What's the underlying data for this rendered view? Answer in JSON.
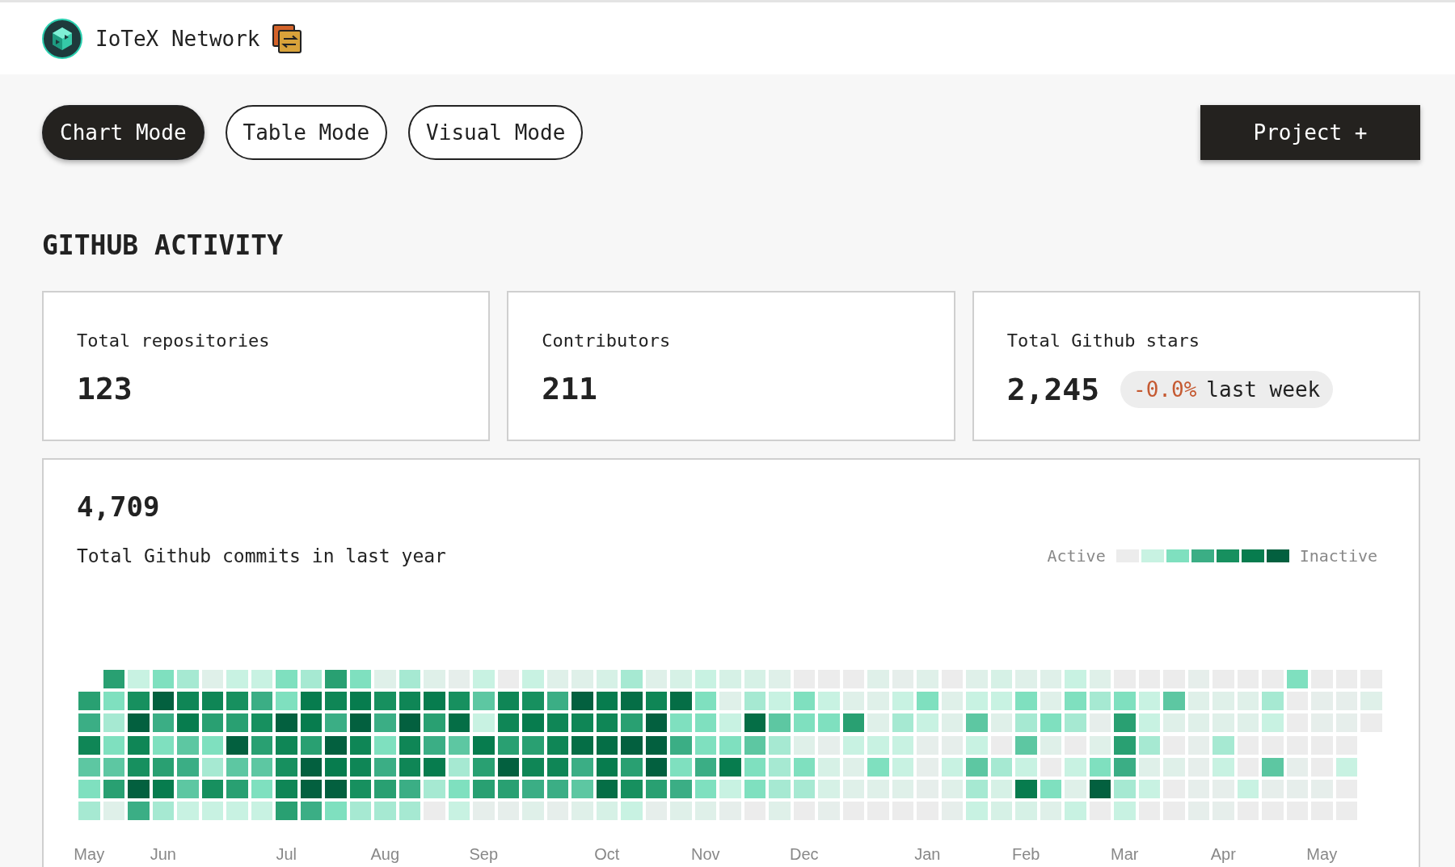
{
  "header": {
    "title": "IoTeX Network"
  },
  "modes": [
    {
      "label": "Chart Mode",
      "selected": true
    },
    {
      "label": "Table Mode",
      "selected": false
    },
    {
      "label": "Visual Mode",
      "selected": false
    }
  ],
  "project_button": "Project +",
  "section_title": "GITHUB ACTIVITY",
  "stats": [
    {
      "label": "Total repositories",
      "value": "123"
    },
    {
      "label": "Contributors",
      "value": "211"
    },
    {
      "label": "Total Github stars",
      "value": "2,245",
      "change": "-0.0%",
      "change_period": "last week"
    }
  ],
  "commits": {
    "total": "4,709",
    "caption": "Total Github commits in last year",
    "legend": {
      "start_label": "Active",
      "end_label": "Inactive",
      "swatches": [
        {
          "color": "#ececec"
        },
        {
          "color": "#c8f2e2"
        },
        {
          "color": "#7fe0bf"
        },
        {
          "color": "#3bae85"
        },
        {
          "color": "#17905f"
        },
        {
          "color": "#077c4e"
        },
        {
          "color": "#03603f"
        }
      ]
    },
    "weeks": [
      {
        "month": "May",
        "days": [
          {
            "color": "#29a072"
          },
          {
            "color": "#3bae85"
          },
          {
            "color": "#0f8656"
          },
          {
            "color": "#5dc7a2"
          },
          {
            "color": "#7fe0bf"
          },
          {
            "color": "#a6e9d2"
          }
        ]
      },
      {
        "days": [
          {
            "color": "#29a072"
          },
          {
            "color": "#7fe0bf"
          },
          {
            "color": "#a6e9d2"
          },
          {
            "color": "#7fe0bf"
          },
          {
            "color": "#5dc7a2"
          },
          {
            "color": "#29a072"
          },
          {
            "color": "#dff0e9"
          }
        ]
      },
      {
        "days": [
          {
            "color": "#c8f2e2"
          },
          {
            "color": "#17905f"
          },
          {
            "color": "#03603f"
          },
          {
            "color": "#0f8656"
          },
          {
            "color": "#17905f"
          },
          {
            "color": "#03603f"
          },
          {
            "color": "#3bae85"
          }
        ]
      },
      {
        "month": "Jun",
        "days": [
          {
            "color": "#7fe0bf"
          },
          {
            "color": "#03603f"
          },
          {
            "color": "#3bae85"
          },
          {
            "color": "#7fe0bf"
          },
          {
            "color": "#29a072"
          },
          {
            "color": "#077c4e"
          },
          {
            "color": "#a6e9d2"
          }
        ]
      },
      {
        "days": [
          {
            "color": "#a6e9d2"
          },
          {
            "color": "#0f8656"
          },
          {
            "color": "#077c4e"
          },
          {
            "color": "#5dc7a2"
          },
          {
            "color": "#3bae85"
          },
          {
            "color": "#5dc7a2"
          },
          {
            "color": "#c8f2e2"
          }
        ]
      },
      {
        "days": [
          {
            "color": "#dff0e9"
          },
          {
            "color": "#0f8656"
          },
          {
            "color": "#29a072"
          },
          {
            "color": "#7fe0bf"
          },
          {
            "color": "#a6e9d2"
          },
          {
            "color": "#17905f"
          },
          {
            "color": "#c8f2e2"
          }
        ]
      },
      {
        "days": [
          {
            "color": "#c8f2e2"
          },
          {
            "color": "#17905f"
          },
          {
            "color": "#29a072"
          },
          {
            "color": "#03603f"
          },
          {
            "color": "#5dc7a2"
          },
          {
            "color": "#29a072"
          },
          {
            "color": "#c8f2e2"
          }
        ]
      },
      {
        "days": [
          {
            "color": "#c8f2e2"
          },
          {
            "color": "#3bae85"
          },
          {
            "color": "#17905f"
          },
          {
            "color": "#29a072"
          },
          {
            "color": "#5dc7a2"
          },
          {
            "color": "#7fe0bf"
          },
          {
            "color": "#c8f2e2"
          }
        ]
      },
      {
        "month": "Jul",
        "days": [
          {
            "color": "#7fe0bf"
          },
          {
            "color": "#7fe0bf"
          },
          {
            "color": "#03603f"
          },
          {
            "color": "#0f8656"
          },
          {
            "color": "#17905f"
          },
          {
            "color": "#0f8656"
          },
          {
            "color": "#29a072"
          }
        ]
      },
      {
        "days": [
          {
            "color": "#a6e9d2"
          },
          {
            "color": "#077c4e"
          },
          {
            "color": "#077c4e"
          },
          {
            "color": "#29a072"
          },
          {
            "color": "#03603f"
          },
          {
            "color": "#03603f"
          },
          {
            "color": "#3bae85"
          }
        ]
      },
      {
        "days": [
          {
            "color": "#29a072"
          },
          {
            "color": "#0f8656"
          },
          {
            "color": "#3bae85"
          },
          {
            "color": "#03603f"
          },
          {
            "color": "#077c4e"
          },
          {
            "color": "#03603f"
          },
          {
            "color": "#7fe0bf"
          }
        ]
      },
      {
        "days": [
          {
            "color": "#7fe0bf"
          },
          {
            "color": "#077c4e"
          },
          {
            "color": "#03603f"
          },
          {
            "color": "#0f8656"
          },
          {
            "color": "#0f8656"
          },
          {
            "color": "#17905f"
          },
          {
            "color": "#a6e9d2"
          }
        ]
      },
      {
        "month": "Aug",
        "days": [
          {
            "color": "#dff0e9"
          },
          {
            "color": "#17905f"
          },
          {
            "color": "#3bae85"
          },
          {
            "color": "#7fe0bf"
          },
          {
            "color": "#3bae85"
          },
          {
            "color": "#29a072"
          },
          {
            "color": "#a6e9d2"
          }
        ]
      },
      {
        "days": [
          {
            "color": "#a6e9d2"
          },
          {
            "color": "#0f8656"
          },
          {
            "color": "#03603f"
          },
          {
            "color": "#0f8656"
          },
          {
            "color": "#0f8656"
          },
          {
            "color": "#3bae85"
          },
          {
            "color": "#a6e9d2"
          }
        ]
      },
      {
        "days": [
          {
            "color": "#dff0e9"
          },
          {
            "color": "#077c4e"
          },
          {
            "color": "#29a072"
          },
          {
            "color": "#3bae85"
          },
          {
            "color": "#077c4e"
          },
          {
            "color": "#a6e9d2"
          },
          {
            "color": "#ececec"
          }
        ]
      },
      {
        "days": [
          {
            "color": "#e6eeeb"
          },
          {
            "color": "#17905f"
          },
          {
            "color": "#056e46"
          },
          {
            "color": "#5dc7a2"
          },
          {
            "color": "#a6e9d2"
          },
          {
            "color": "#7fe0bf"
          },
          {
            "color": "#c8f2e2"
          }
        ]
      },
      {
        "month": "Sep",
        "days": [
          {
            "color": "#c8f2e2"
          },
          {
            "color": "#5dc7a2"
          },
          {
            "color": "#c8f2e2"
          },
          {
            "color": "#077c4e"
          },
          {
            "color": "#29a072"
          },
          {
            "color": "#29a072"
          },
          {
            "color": "#e6eeeb"
          }
        ]
      },
      {
        "days": [
          {
            "color": "#ececec"
          },
          {
            "color": "#0f8656"
          },
          {
            "color": "#0f8656"
          },
          {
            "color": "#29a072"
          },
          {
            "color": "#03603f"
          },
          {
            "color": "#29a072"
          },
          {
            "color": "#e6eeeb"
          }
        ]
      },
      {
        "days": [
          {
            "color": "#c8f2e2"
          },
          {
            "color": "#17905f"
          },
          {
            "color": "#077c4e"
          },
          {
            "color": "#29a072"
          },
          {
            "color": "#0f8656"
          },
          {
            "color": "#3bae85"
          },
          {
            "color": "#dff0e9"
          }
        ]
      },
      {
        "days": [
          {
            "color": "#dff0e9"
          },
          {
            "color": "#3bae85"
          },
          {
            "color": "#0f8656"
          },
          {
            "color": "#0f8656"
          },
          {
            "color": "#0f8656"
          },
          {
            "color": "#3bae85"
          },
          {
            "color": "#e6eeeb"
          }
        ]
      },
      {
        "days": [
          {
            "color": "#dff0e9"
          },
          {
            "color": "#03603f"
          },
          {
            "color": "#0f8656"
          },
          {
            "color": "#056e46"
          },
          {
            "color": "#3bae85"
          },
          {
            "color": "#5dc7a2"
          },
          {
            "color": "#dff0e9"
          }
        ]
      },
      {
        "month": "Oct",
        "days": [
          {
            "color": "#d6f1e6"
          },
          {
            "color": "#077c4e"
          },
          {
            "color": "#0f8656"
          },
          {
            "color": "#056e46"
          },
          {
            "color": "#077c4e"
          },
          {
            "color": "#056e46"
          },
          {
            "color": "#d6f1e6"
          }
        ]
      },
      {
        "days": [
          {
            "color": "#a6e9d2"
          },
          {
            "color": "#056e46"
          },
          {
            "color": "#29a072"
          },
          {
            "color": "#03603f"
          },
          {
            "color": "#29a072"
          },
          {
            "color": "#17905f"
          },
          {
            "color": "#c8f2e2"
          }
        ]
      },
      {
        "days": [
          {
            "color": "#dff0e9"
          },
          {
            "color": "#0f8656"
          },
          {
            "color": "#03603f"
          },
          {
            "color": "#03603f"
          },
          {
            "color": "#03603f"
          },
          {
            "color": "#29a072"
          },
          {
            "color": "#e6eeeb"
          }
        ]
      },
      {
        "days": [
          {
            "color": "#d6f1e6"
          },
          {
            "color": "#056e46"
          },
          {
            "color": "#7fe0bf"
          },
          {
            "color": "#3bae85"
          },
          {
            "color": "#7fe0bf"
          },
          {
            "color": "#3bae85"
          },
          {
            "color": "#dff0e9"
          }
        ]
      },
      {
        "month": "Nov",
        "days": [
          {
            "color": "#c8f2e2"
          },
          {
            "color": "#7fe0bf"
          },
          {
            "color": "#7fe0bf"
          },
          {
            "color": "#7fe0bf"
          },
          {
            "color": "#3bae85"
          },
          {
            "color": "#7fe0bf"
          },
          {
            "color": "#dff0e9"
          }
        ]
      },
      {
        "days": [
          {
            "color": "#d6f1e6"
          },
          {
            "color": "#dff0e9"
          },
          {
            "color": "#c8f2e2"
          },
          {
            "color": "#7fe0bf"
          },
          {
            "color": "#077c4e"
          },
          {
            "color": "#c8f2e2"
          },
          {
            "color": "#e6eeeb"
          }
        ]
      },
      {
        "days": [
          {
            "color": "#d6f1e6"
          },
          {
            "color": "#a6e9d2"
          },
          {
            "color": "#056e46"
          },
          {
            "color": "#5dc7a2"
          },
          {
            "color": "#7fe0bf"
          },
          {
            "color": "#7fe0bf"
          },
          {
            "color": "#ececec"
          }
        ]
      },
      {
        "days": [
          {
            "color": "#dff0e9"
          },
          {
            "color": "#c8f2e2"
          },
          {
            "color": "#5dc7a2"
          },
          {
            "color": "#a6e9d2"
          },
          {
            "color": "#a6e9d2"
          },
          {
            "color": "#a6e9d2"
          },
          {
            "color": "#dff0e9"
          }
        ]
      },
      {
        "month": "Dec",
        "days": [
          {
            "color": "#ececec"
          },
          {
            "color": "#7fe0bf"
          },
          {
            "color": "#7fe0bf"
          },
          {
            "color": "#dff0e9"
          },
          {
            "color": "#7fe0bf"
          },
          {
            "color": "#a6e9d2"
          },
          {
            "color": "#ececec"
          }
        ]
      },
      {
        "days": [
          {
            "color": "#ececec"
          },
          {
            "color": "#c8f2e2"
          },
          {
            "color": "#7fe0bf"
          },
          {
            "color": "#e6eeeb"
          },
          {
            "color": "#d6f1e6"
          },
          {
            "color": "#d6f1e6"
          },
          {
            "color": "#e6eeeb"
          }
        ]
      },
      {
        "days": [
          {
            "color": "#ececec"
          },
          {
            "color": "#dff0e9"
          },
          {
            "color": "#29a072"
          },
          {
            "color": "#c8f2e2"
          },
          {
            "color": "#dff0e9"
          },
          {
            "color": "#dff0e9"
          },
          {
            "color": "#ececec"
          }
        ]
      },
      {
        "days": [
          {
            "color": "#dff0e9"
          },
          {
            "color": "#dff0e9"
          },
          {
            "color": "#dff0e9"
          },
          {
            "color": "#c8f2e2"
          },
          {
            "color": "#7fe0bf"
          },
          {
            "color": "#dff0e9"
          },
          {
            "color": "#ececec"
          }
        ]
      },
      {
        "days": [
          {
            "color": "#e6eeeb"
          },
          {
            "color": "#c8f2e2"
          },
          {
            "color": "#a6e9d2"
          },
          {
            "color": "#c8f2e2"
          },
          {
            "color": "#c8f2e2"
          },
          {
            "color": "#dff0e9"
          },
          {
            "color": "#ececec"
          }
        ]
      },
      {
        "month": "Jan",
        "days": [
          {
            "color": "#dff0e9"
          },
          {
            "color": "#7fe0bf"
          },
          {
            "color": "#c8f2e2"
          },
          {
            "color": "#e6eeeb"
          },
          {
            "color": "#e6eeeb"
          },
          {
            "color": "#e6eeeb"
          },
          {
            "color": "#ececec"
          }
        ]
      },
      {
        "days": [
          {
            "color": "#ececec"
          },
          {
            "color": "#dff0e9"
          },
          {
            "color": "#dff0e9"
          },
          {
            "color": "#e6eeeb"
          },
          {
            "color": "#c8f2e2"
          },
          {
            "color": "#dff0e9"
          },
          {
            "color": "#e6eeeb"
          }
        ]
      },
      {
        "days": [
          {
            "color": "#dff0e9"
          },
          {
            "color": "#c8f2e2"
          },
          {
            "color": "#5dc7a2"
          },
          {
            "color": "#c8f2e2"
          },
          {
            "color": "#5dc7a2"
          },
          {
            "color": "#a6e9d2"
          },
          {
            "color": "#c8f2e2"
          }
        ]
      },
      {
        "days": [
          {
            "color": "#d6f1e6"
          },
          {
            "color": "#c8f2e2"
          },
          {
            "color": "#dff0e9"
          },
          {
            "color": "#ececec"
          },
          {
            "color": "#a6e9d2"
          },
          {
            "color": "#d6f1e6"
          },
          {
            "color": "#d6f1e6"
          }
        ]
      },
      {
        "month": "Feb",
        "days": [
          {
            "color": "#dff0e9"
          },
          {
            "color": "#7fe0bf"
          },
          {
            "color": "#a6e9d2"
          },
          {
            "color": "#5dc7a2"
          },
          {
            "color": "#c8f2e2"
          },
          {
            "color": "#077c4e"
          },
          {
            "color": "#d6f1e6"
          }
        ]
      },
      {
        "days": [
          {
            "color": "#dff0e9"
          },
          {
            "color": "#dff0e9"
          },
          {
            "color": "#7fe0bf"
          },
          {
            "color": "#dff0e9"
          },
          {
            "color": "#ececec"
          },
          {
            "color": "#7fe0bf"
          },
          {
            "color": "#dff0e9"
          }
        ]
      },
      {
        "days": [
          {
            "color": "#c8f2e2"
          },
          {
            "color": "#7fe0bf"
          },
          {
            "color": "#a6e9d2"
          },
          {
            "color": "#ececec"
          },
          {
            "color": "#c8f2e2"
          },
          {
            "color": "#dff0e9"
          },
          {
            "color": "#c8f2e2"
          }
        ]
      },
      {
        "days": [
          {
            "color": "#dff0e9"
          },
          {
            "color": "#a6e9d2"
          },
          {
            "color": "#e6eeeb"
          },
          {
            "color": "#dff0e9"
          },
          {
            "color": "#7fe0bf"
          },
          {
            "color": "#03603f"
          },
          {
            "color": "#ececec"
          }
        ]
      },
      {
        "month": "Mar",
        "days": [
          {
            "color": "#ececec"
          },
          {
            "color": "#7fe0bf"
          },
          {
            "color": "#29a072"
          },
          {
            "color": "#29a072"
          },
          {
            "color": "#3bae85"
          },
          {
            "color": "#a6e9d2"
          },
          {
            "color": "#c8f2e2"
          }
        ]
      },
      {
        "days": [
          {
            "color": "#ececec"
          },
          {
            "color": "#c8f2e2"
          },
          {
            "color": "#c8f2e2"
          },
          {
            "color": "#a6e9d2"
          },
          {
            "color": "#dff0e9"
          },
          {
            "color": "#c8f2e2"
          },
          {
            "color": "#ececec"
          }
        ]
      },
      {
        "days": [
          {
            "color": "#ececec"
          },
          {
            "color": "#5dc7a2"
          },
          {
            "color": "#dff0e9"
          },
          {
            "color": "#ececec"
          },
          {
            "color": "#dff0e9"
          },
          {
            "color": "#ececec"
          },
          {
            "color": "#ececec"
          }
        ]
      },
      {
        "days": [
          {
            "color": "#e6eeeb"
          },
          {
            "color": "#dff0e9"
          },
          {
            "color": "#dff0e9"
          },
          {
            "color": "#e6eeeb"
          },
          {
            "color": "#e6eeeb"
          },
          {
            "color": "#e6eeeb"
          },
          {
            "color": "#e6eeeb"
          }
        ]
      },
      {
        "month": "Apr",
        "days": [
          {
            "color": "#ececec"
          },
          {
            "color": "#dff0e9"
          },
          {
            "color": "#dff0e9"
          },
          {
            "color": "#a6e9d2"
          },
          {
            "color": "#c8f2e2"
          },
          {
            "color": "#e6eeeb"
          },
          {
            "color": "#e6eeeb"
          }
        ]
      },
      {
        "days": [
          {
            "color": "#ececec"
          },
          {
            "color": "#dff0e9"
          },
          {
            "color": "#dff0e9"
          },
          {
            "color": "#ececec"
          },
          {
            "color": "#ececec"
          },
          {
            "color": "#c8f2e2"
          },
          {
            "color": "#ececec"
          }
        ]
      },
      {
        "days": [
          {
            "color": "#ececec"
          },
          {
            "color": "#a6e9d2"
          },
          {
            "color": "#c8f2e2"
          },
          {
            "color": "#ececec"
          },
          {
            "color": "#5dc7a2"
          },
          {
            "color": "#e6eeeb"
          },
          {
            "color": "#ececec"
          }
        ]
      },
      {
        "days": [
          {
            "color": "#7fe0bf"
          },
          {
            "color": "#ececec"
          },
          {
            "color": "#ececec"
          },
          {
            "color": "#ececec"
          },
          {
            "color": "#e6eeeb"
          },
          {
            "color": "#e6eeeb"
          },
          {
            "color": "#ececec"
          }
        ]
      },
      {
        "month": "May",
        "days": [
          {
            "color": "#ececec"
          },
          {
            "color": "#e6eeeb"
          },
          {
            "color": "#e6eeeb"
          },
          {
            "color": "#ececec"
          },
          {
            "color": "#ececec"
          },
          {
            "color": "#e6eeeb"
          },
          {
            "color": "#ececec"
          }
        ]
      },
      {
        "days": [
          {
            "color": "#ececec"
          },
          {
            "color": "#e6eeeb"
          },
          {
            "color": "#e6eeeb"
          },
          {
            "color": "#ececec"
          },
          {
            "color": "#c8f2e2"
          },
          {
            "color": "#ececec"
          },
          {
            "color": "#ececec"
          }
        ]
      },
      {
        "days": [
          {
            "color": "#ececec"
          },
          {
            "color": "#dff0e9"
          },
          {
            "color": "#ececec"
          }
        ]
      }
    ]
  }
}
